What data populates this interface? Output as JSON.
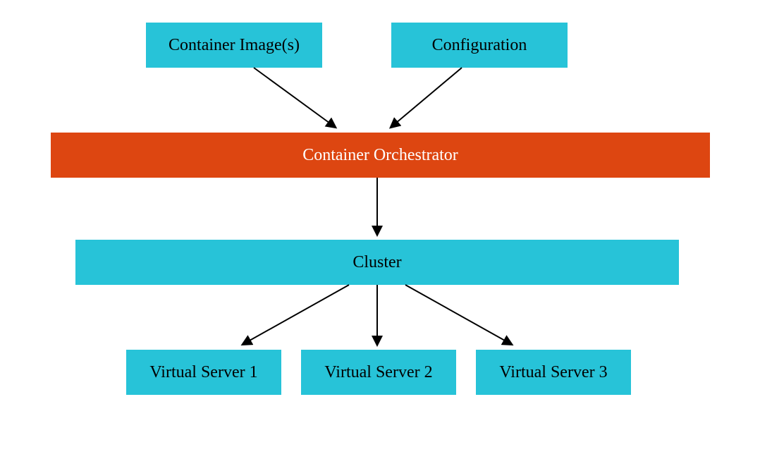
{
  "nodes": {
    "container_images": "Container Image(s)",
    "configuration": "Configuration",
    "orchestrator": "Container Orchestrator",
    "cluster": "Cluster",
    "vs1": "Virtual Server 1",
    "vs2": "Virtual Server 2",
    "vs3": "Virtual Server 3"
  }
}
